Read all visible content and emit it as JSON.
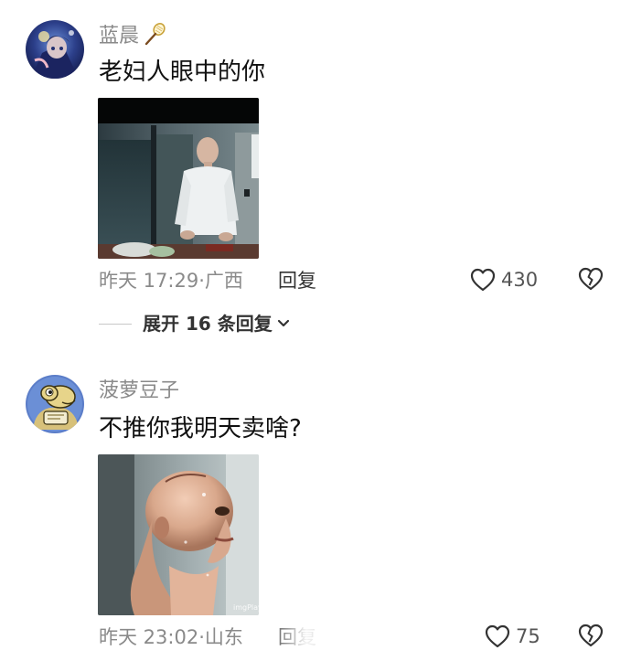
{
  "comments": [
    {
      "username": "蓝晨",
      "text": "老妇人眼中的你",
      "time": "昨天 17:29",
      "location": "广西",
      "reply_label": "回复",
      "likes": "430",
      "expand_label": "展开 16 条回复"
    },
    {
      "username": "菠萝豆子",
      "text": "不推你我明天卖啥?",
      "time": "昨天 23:02",
      "location": "山东",
      "reply_label": "回复",
      "likes": "75"
    }
  ],
  "icons": {
    "like": "heart-outline-icon",
    "dislike": "broken-heart-icon",
    "expand": "chevron-down-icon",
    "badge": "badminton-racket-icon"
  },
  "media_watermark": "imgPlay",
  "colors": {
    "muted_text": "#8a8a8a",
    "primary_text": "#111111",
    "divider": "#c8c8c8"
  }
}
